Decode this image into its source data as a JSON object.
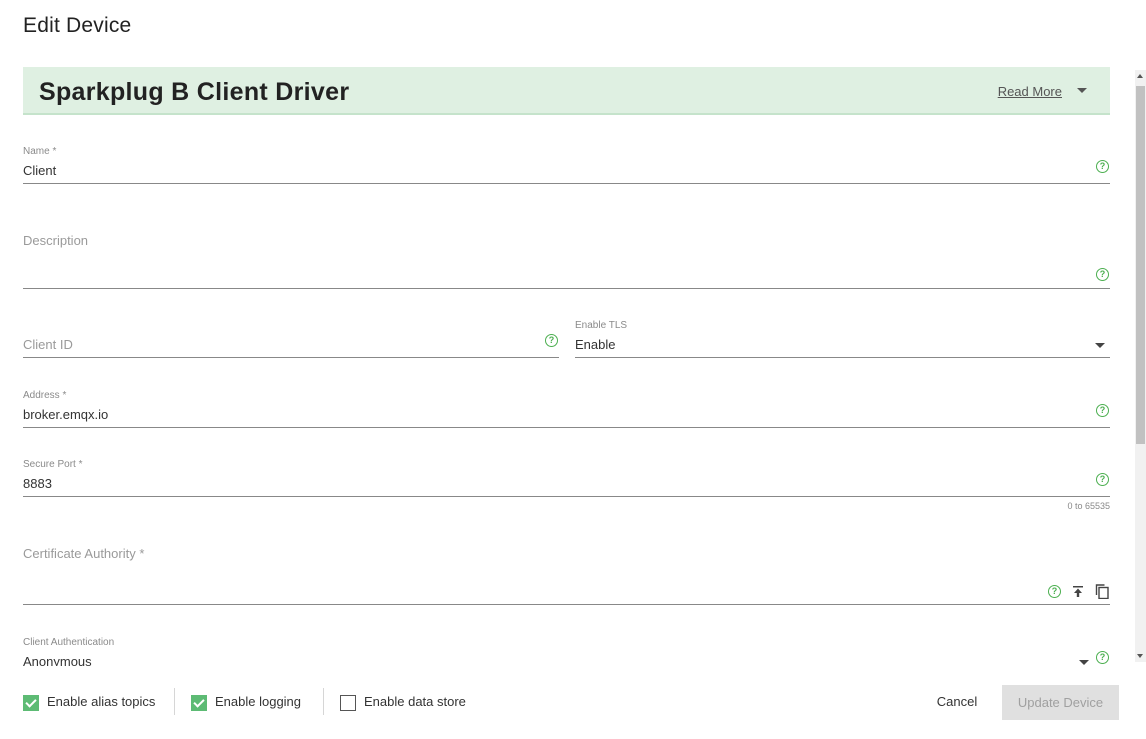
{
  "dialog": {
    "title": "Edit Device"
  },
  "banner": {
    "title": "Sparkplug B Client Driver",
    "read_more": "Read More"
  },
  "form": {
    "name": {
      "label": "Name *",
      "value": "Client"
    },
    "description": {
      "label": "Description",
      "value": ""
    },
    "client_id": {
      "label": "Client ID",
      "value": ""
    },
    "enable_tls": {
      "label": "Enable TLS",
      "value": "Enable"
    },
    "address": {
      "label": "Address *",
      "value": "broker.emqx.io"
    },
    "secure_port": {
      "label": "Secure Port *",
      "value": "8883",
      "hint": "0 to 65535"
    },
    "certificate_authority": {
      "label": "Certificate Authority *",
      "value": ""
    },
    "client_authentication": {
      "label": "Client Authentication",
      "value": "Anonymous"
    }
  },
  "footer": {
    "checkboxes": [
      {
        "label": "Enable alias topics",
        "checked": true
      },
      {
        "label": "Enable logging",
        "checked": true
      },
      {
        "label": "Enable data store",
        "checked": false
      }
    ],
    "cancel_label": "Cancel",
    "update_label": "Update Device"
  },
  "colors": {
    "accent": "#4caf50",
    "banner_bg": "#dff0e2",
    "disabled_button": "#e0e0e0"
  },
  "icons": {
    "help": "help-circle-icon",
    "upload": "upload-icon",
    "copy": "copy-icon",
    "dropdown": "caret-down-icon"
  }
}
